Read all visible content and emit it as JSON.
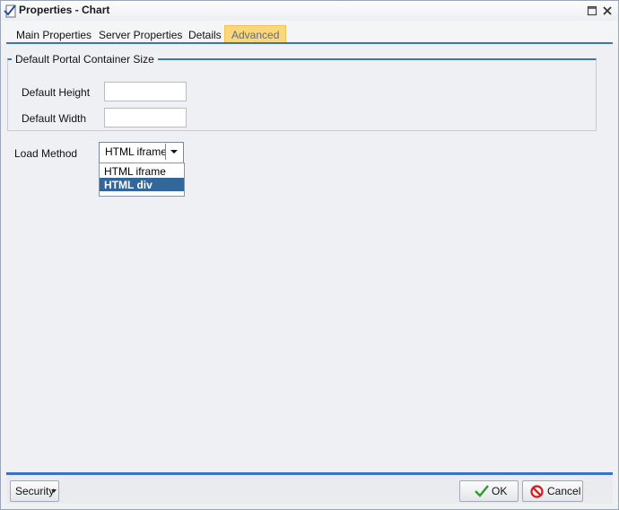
{
  "window": {
    "title": "Properties - Chart"
  },
  "tabs": [
    {
      "label": "Main Properties"
    },
    {
      "label": "Server Properties"
    },
    {
      "label": "Details"
    },
    {
      "label": "Advanced"
    }
  ],
  "container_size": {
    "legend": "Default Portal Container Size",
    "height_label": "Default Height",
    "height_value": "",
    "width_label": "Default Width",
    "width_value": ""
  },
  "load_method": {
    "label": "Load Method",
    "selected": "HTML iframe",
    "options": [
      "HTML iframe",
      "HTML div"
    ],
    "highlighted": "HTML div"
  },
  "footer": {
    "security_label": "Security",
    "ok_label": "OK",
    "cancel_label": "Cancel"
  },
  "colors": {
    "accent": "#3b72c4",
    "active_tab": "#fbd77a",
    "highlight": "#336699"
  }
}
